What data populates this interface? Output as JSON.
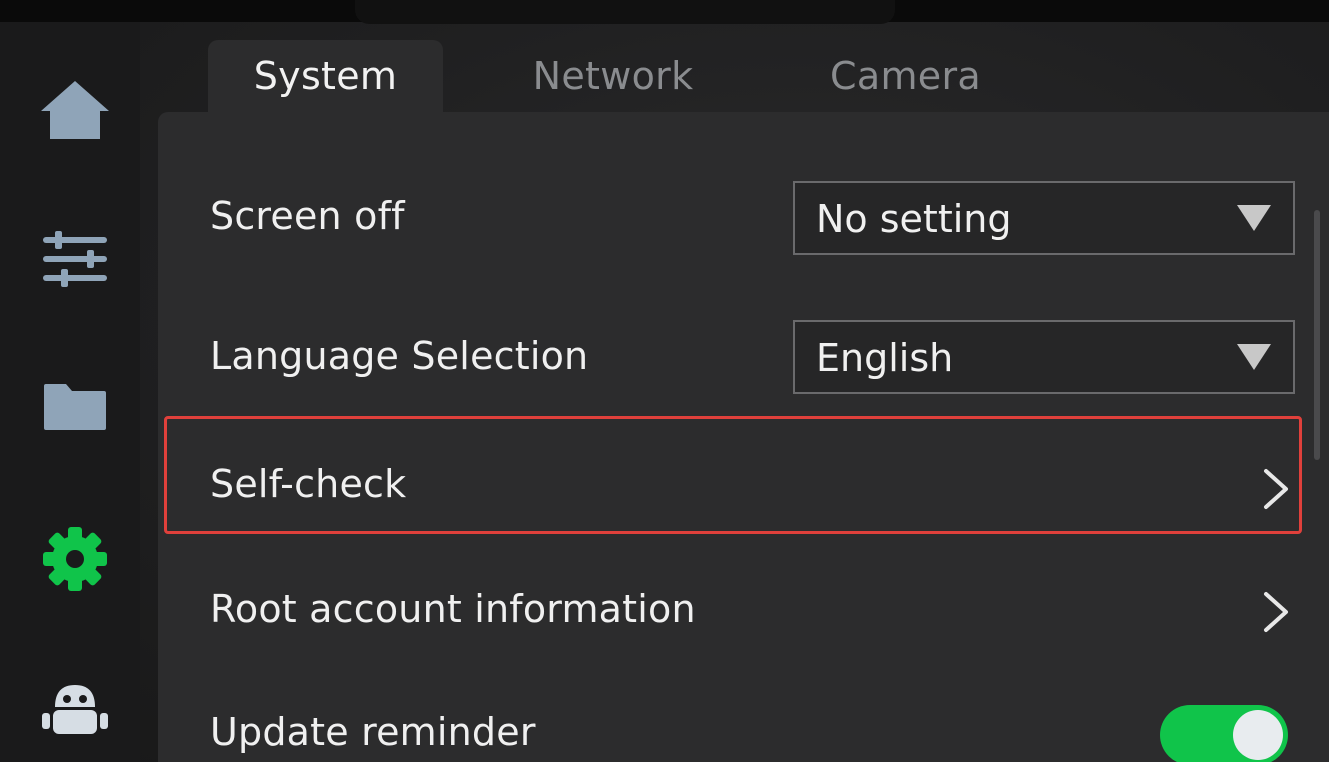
{
  "tabs": [
    {
      "label": "System",
      "active": true
    },
    {
      "label": "Network",
      "active": false
    },
    {
      "label": "Camera",
      "active": false
    }
  ],
  "sidebar": {
    "items": [
      {
        "icon": "home-icon"
      },
      {
        "icon": "sliders-icon"
      },
      {
        "icon": "folder-icon"
      },
      {
        "icon": "gear-icon",
        "active": true
      },
      {
        "icon": "robot-icon"
      }
    ]
  },
  "settings": {
    "screen_off": {
      "label": "Screen off",
      "value": "No setting"
    },
    "language": {
      "label": "Language Selection",
      "value": "English"
    },
    "self_check": {
      "label": "Self-check"
    },
    "root_account": {
      "label": "Root account information"
    },
    "update_reminder": {
      "label": "Update reminder",
      "enabled": true
    }
  },
  "colors": {
    "accent": "#10c44a",
    "highlight": "#e0403b",
    "inactive_icon": "#8fa4b8"
  }
}
